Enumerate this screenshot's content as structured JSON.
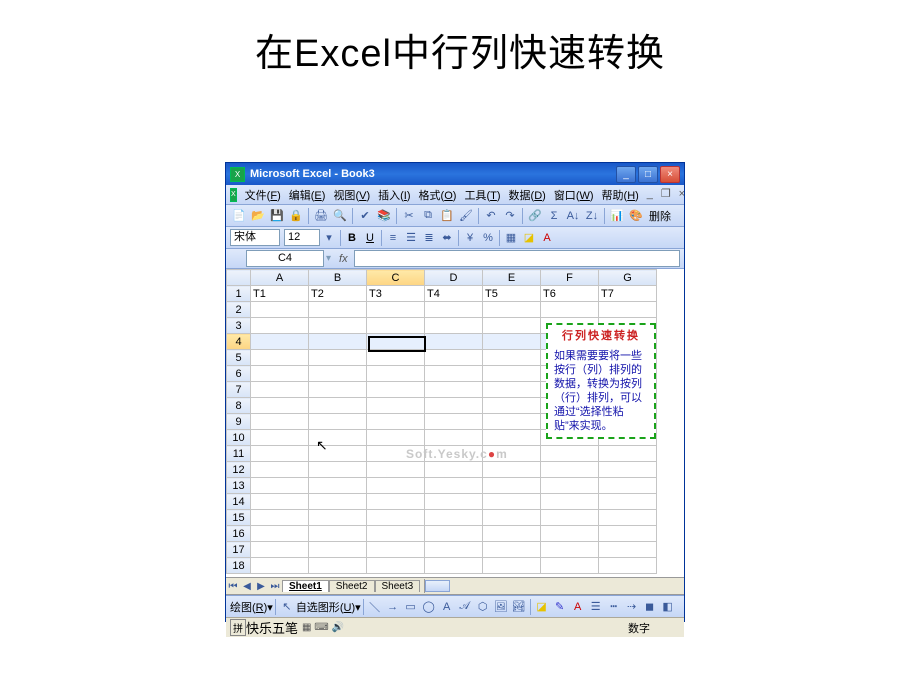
{
  "slide": {
    "title": "在Excel中行列快速转换"
  },
  "window": {
    "title": "Microsoft Excel - Book3",
    "minimize": "_",
    "maximize": "□",
    "close": "×"
  },
  "menus": {
    "file": {
      "label": "文件",
      "mn": "F"
    },
    "edit": {
      "label": "编辑",
      "mn": "E"
    },
    "view": {
      "label": "视图",
      "mn": "V"
    },
    "insert": {
      "label": "插入",
      "mn": "I"
    },
    "format": {
      "label": "格式",
      "mn": "O"
    },
    "tools": {
      "label": "工具",
      "mn": "T"
    },
    "data": {
      "label": "数据",
      "mn": "D"
    },
    "windowm": {
      "label": "窗口",
      "mn": "W"
    },
    "help": {
      "label": "帮助",
      "mn": "H"
    }
  },
  "toolbar": {
    "delete": "删除"
  },
  "format": {
    "font_name": "宋体",
    "font_size": "12"
  },
  "namebox": {
    "ref": "C4"
  },
  "grid": {
    "cols": [
      "A",
      "B",
      "C",
      "D",
      "E",
      "F",
      "G"
    ],
    "rows": [
      "1",
      "2",
      "3",
      "4",
      "5",
      "6",
      "7",
      "8",
      "9",
      "10",
      "11",
      "12",
      "13",
      "14",
      "15",
      "16",
      "17",
      "18"
    ],
    "row1": [
      "T1",
      "T2",
      "T3",
      "T4",
      "T5",
      "T6",
      "T7"
    ],
    "selected_col": "C",
    "selected_row": "4"
  },
  "callout": {
    "title": "行列快速转换",
    "body": "如果需要要将一些按行（列）排列的数据，转换为按列（行）排列，可以通过“选择性粘贴”来实现。"
  },
  "watermark": {
    "left": "Soft.Yesky.c",
    "right": "m"
  },
  "sheets": {
    "s1": "Sheet1",
    "s2": "Sheet2",
    "s3": "Sheet3"
  },
  "drawbar": {
    "draw": "绘图",
    "draw_mn": "R",
    "autoshape": "自选图形",
    "autoshape_mn": "U"
  },
  "ime": {
    "name": "快乐五笔",
    "status": "数字"
  }
}
